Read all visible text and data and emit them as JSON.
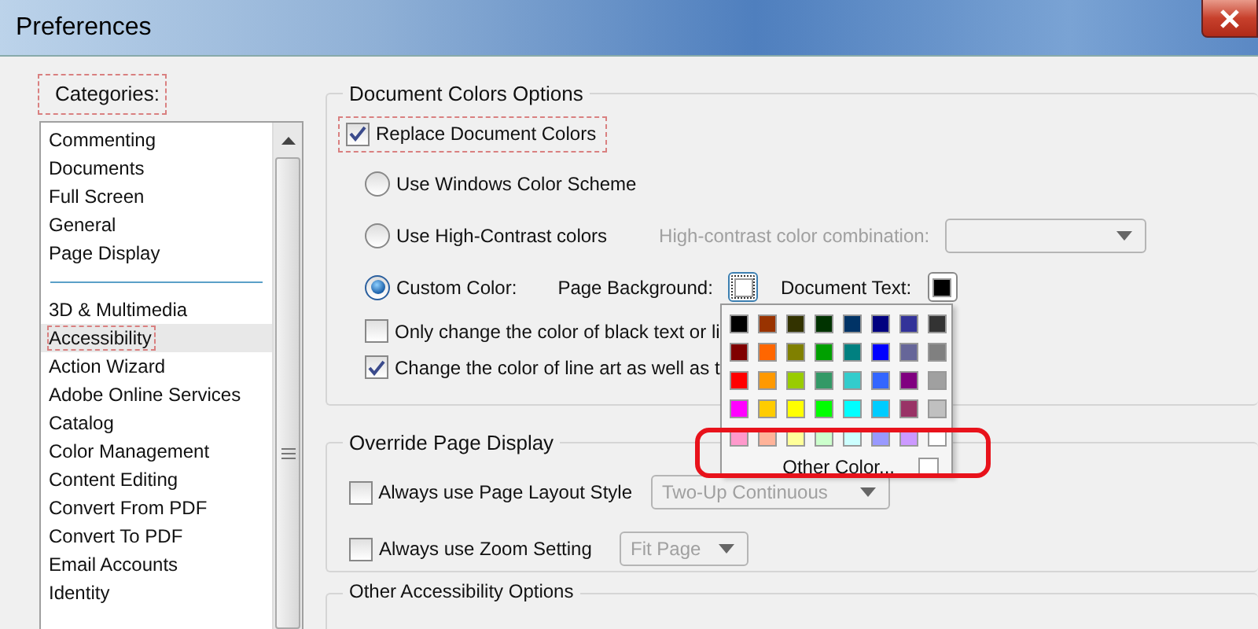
{
  "window": {
    "title": "Preferences"
  },
  "categories": {
    "label": "Categories:",
    "annotated": true,
    "groups": [
      {
        "items": [
          {
            "label": "Commenting",
            "selected": false,
            "annotated": false
          },
          {
            "label": "Documents",
            "selected": false,
            "annotated": false
          },
          {
            "label": "Full Screen",
            "selected": false,
            "annotated": false
          },
          {
            "label": "General",
            "selected": false,
            "annotated": false
          },
          {
            "label": "Page Display",
            "selected": false,
            "annotated": false
          }
        ]
      },
      {
        "items": [
          {
            "label": "3D & Multimedia",
            "selected": false,
            "annotated": false
          },
          {
            "label": "Accessibility",
            "selected": true,
            "annotated": true
          },
          {
            "label": "Action Wizard",
            "selected": false,
            "annotated": false
          },
          {
            "label": "Adobe Online Services",
            "selected": false,
            "annotated": false
          },
          {
            "label": "Catalog",
            "selected": false,
            "annotated": false
          },
          {
            "label": "Color Management",
            "selected": false,
            "annotated": false
          },
          {
            "label": "Content Editing",
            "selected": false,
            "annotated": false
          },
          {
            "label": "Convert From PDF",
            "selected": false,
            "annotated": false
          },
          {
            "label": "Convert To PDF",
            "selected": false,
            "annotated": false
          },
          {
            "label": "Email Accounts",
            "selected": false,
            "annotated": false
          },
          {
            "label": "Identity",
            "selected": false,
            "annotated": false
          }
        ]
      }
    ]
  },
  "document_colors": {
    "title": "Document Colors Options",
    "replace": {
      "label": "Replace Document Colors",
      "checked": true,
      "annotated": true
    },
    "radios": [
      {
        "label": "Use Windows Color Scheme",
        "selected": false
      },
      {
        "label": "Use High-Contrast colors",
        "selected": false
      },
      {
        "label": "Custom Color:",
        "selected": true
      }
    ],
    "high_contrast_label": "High-contrast color combination:",
    "page_background": {
      "label": "Page Background:",
      "color": "#ffffff"
    },
    "document_text": {
      "label": "Document Text:",
      "color": "#000000"
    },
    "checkboxes": [
      {
        "label": "Only change the color of black text or li",
        "checked": false
      },
      {
        "label": "Change the color of line art as well as t",
        "checked": true
      }
    ]
  },
  "color_menu": {
    "swatches": [
      {
        "color": "#000000"
      },
      {
        "color": "#993300"
      },
      {
        "color": "#333300"
      },
      {
        "color": "#003300"
      },
      {
        "color": "#003366"
      },
      {
        "color": "#000080"
      },
      {
        "color": "#333399"
      },
      {
        "color": "#333333"
      },
      {
        "color": "#800000"
      },
      {
        "color": "#ff6600"
      },
      {
        "color": "#808000"
      },
      {
        "color": "#00a000"
      },
      {
        "color": "#008080"
      },
      {
        "color": "#0000ff"
      },
      {
        "color": "#666699"
      },
      {
        "color": "#808080"
      },
      {
        "color": "#ff0000"
      },
      {
        "color": "#ff9900"
      },
      {
        "color": "#99cc00"
      },
      {
        "color": "#339966"
      },
      {
        "color": "#33cccc"
      },
      {
        "color": "#3366ff"
      },
      {
        "color": "#800080"
      },
      {
        "color": "#a0a0a0"
      },
      {
        "color": "#ff00ff"
      },
      {
        "color": "#ffcc00"
      },
      {
        "color": "#ffff00"
      },
      {
        "color": "#00ff00"
      },
      {
        "color": "#00ffff"
      },
      {
        "color": "#00ccff"
      },
      {
        "color": "#993366"
      },
      {
        "color": "#c0c0c0"
      },
      {
        "color": "#ff99cc"
      },
      {
        "color": "#ffb399"
      },
      {
        "color": "#ffff99"
      },
      {
        "color": "#ccffcc"
      },
      {
        "color": "#ccffff"
      },
      {
        "color": "#9999ff"
      },
      {
        "color": "#cc99ff"
      },
      {
        "color": "#ffffff"
      }
    ],
    "other_label": "Other Color...",
    "highlighted": true
  },
  "override": {
    "title": "Override Page Display",
    "rows": [
      {
        "label": "Always use Page Layout Style",
        "checked": false,
        "dropdown": "Two-Up Continuous"
      },
      {
        "label": "Always use Zoom Setting",
        "checked": false,
        "dropdown": "Fit Page"
      }
    ]
  },
  "other_options": {
    "title": "Other Accessibility Options"
  }
}
